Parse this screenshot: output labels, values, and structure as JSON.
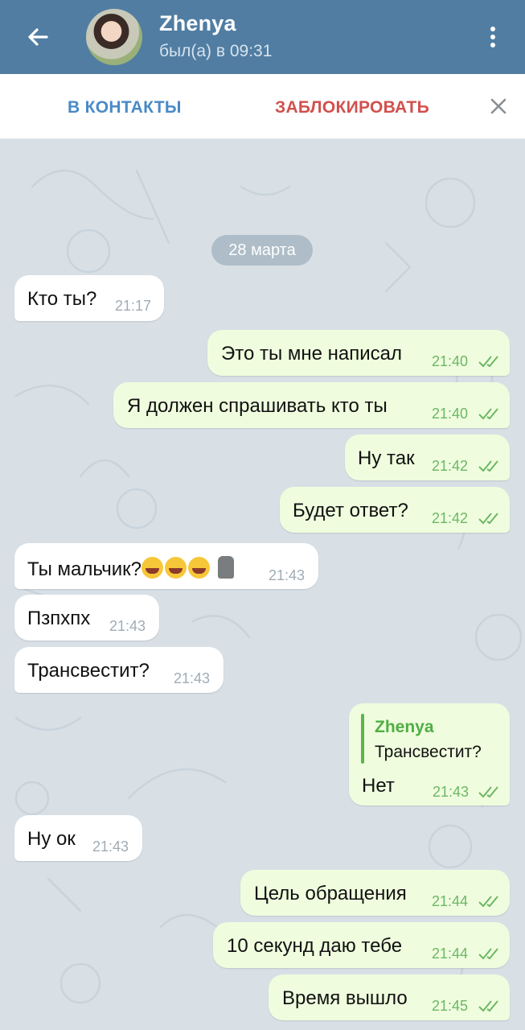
{
  "header": {
    "title": "Zhenya",
    "status": "был(а) в 09:31",
    "back_icon": "arrow-left-icon",
    "menu_icon": "more-vertical-icon"
  },
  "actions": {
    "add_contact": "В КОНТАКТЫ",
    "block": "ЗАБЛОКИРОВАТЬ",
    "close_icon": "close-icon"
  },
  "chat": {
    "date": "28 марта",
    "messages": [
      {
        "dir": "in",
        "text": "Кто ты?",
        "time": "21:17"
      },
      {
        "dir": "out",
        "text": "Это ты мне написал",
        "time": "21:40",
        "read": true
      },
      {
        "dir": "out",
        "text": "Я должен спрашивать кто ты",
        "time": "21:40",
        "read": true
      },
      {
        "dir": "out",
        "text": "Ну так",
        "time": "21:42",
        "read": true
      },
      {
        "dir": "out",
        "text": "Будет ответ?",
        "time": "21:42",
        "read": true
      },
      {
        "dir": "in",
        "text": "Ты мальчик?",
        "emoji": [
          "face-with-tears-of-joy",
          "face-with-tears-of-joy",
          "face-with-tears-of-joy",
          "moai"
        ],
        "time": "21:43"
      },
      {
        "dir": "in",
        "text": "Пзпхпх",
        "time": "21:43"
      },
      {
        "dir": "in",
        "text": "Трансвестит?",
        "time": "21:43"
      },
      {
        "dir": "out",
        "reply_name": "Zhenya",
        "reply_text": "Трансвестит?",
        "text": "Нет",
        "time": "21:43",
        "read": true
      },
      {
        "dir": "in",
        "text": "Ну ок",
        "time": "21:43"
      },
      {
        "dir": "out",
        "text": "Цель обращения",
        "time": "21:44",
        "read": true
      },
      {
        "dir": "out",
        "text": "10 секунд даю тебе",
        "time": "21:44",
        "read": true
      },
      {
        "dir": "out",
        "text": "Время вышло",
        "time": "21:45",
        "read": true
      }
    ]
  },
  "colors": {
    "header": "#517da2",
    "chat_bg": "#d8e0e6",
    "incoming": "#ffffff",
    "outgoing": "#effdde",
    "add_contact": "#4a8ac6",
    "block": "#d1504d",
    "read_check": "#6db765"
  }
}
